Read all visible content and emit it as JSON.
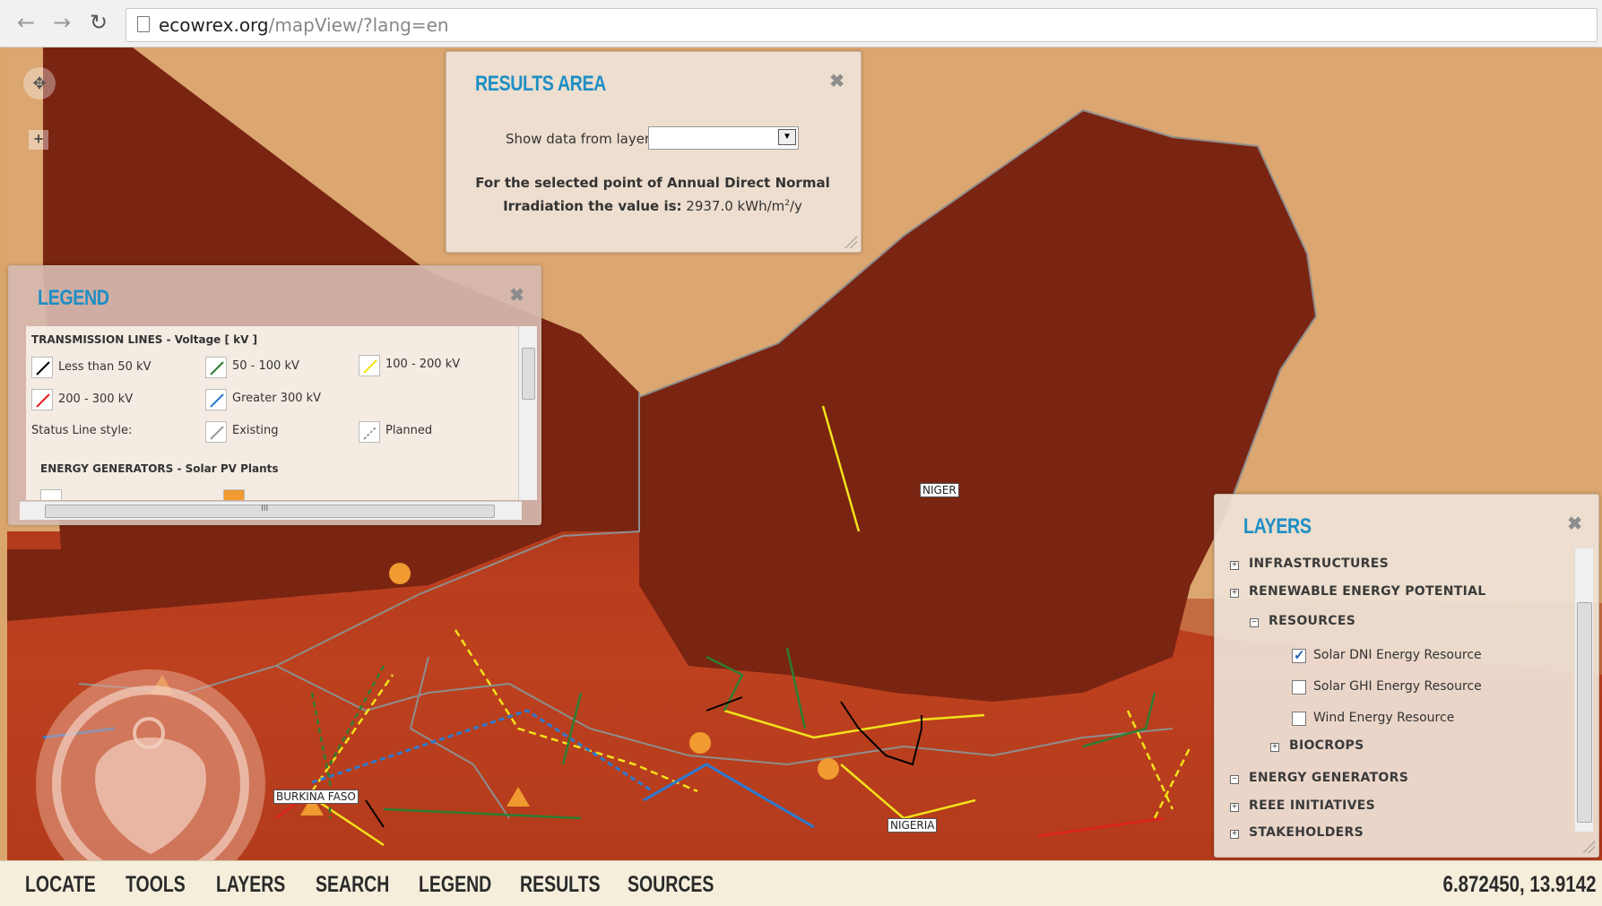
{
  "browser": {
    "url_domain": "ecowrex.org",
    "url_path": "/mapView/?lang=en"
  },
  "map": {
    "labels": {
      "niger": "NIGER",
      "burkina": "BURKINA FASO",
      "nigeria": "NIGERIA"
    }
  },
  "results_panel": {
    "title": "RESULTS AREA",
    "show_label": "Show data from layer:",
    "selected_value": "",
    "msg_line1": "For the selected point of Annual Direct Normal",
    "msg_line2_label": "Irradiation the value is:",
    "msg_value": "2937.0 kWh/m",
    "msg_sup": "2",
    "msg_unit_tail": "/y"
  },
  "legend_panel": {
    "title": "LEGEND",
    "section1": "TRANSMISSION LINES - Voltage [ kV ]",
    "items": [
      {
        "label": "Less than 50 kV",
        "color": "#000000"
      },
      {
        "label": "50 - 100 kV",
        "color": "#2e7d32"
      },
      {
        "label": "100 - 200 kV",
        "color": "#f2e21a"
      },
      {
        "label": "200 - 300 kV",
        "color": "#e02020"
      },
      {
        "label": "Greater 300 kV",
        "color": "#2b7bd1"
      }
    ],
    "status_label": "Status Line style:",
    "existing": "Existing",
    "planned": "Planned",
    "section2": "ENERGY GENERATORS - Solar PV Plants",
    "hscroll_mark": "III"
  },
  "layers_panel": {
    "title": "LAYERS",
    "nodes": {
      "infrastructures": "INFRASTRUCTURES",
      "renewable": "RENEWABLE ENERGY POTENTIAL",
      "resources": "RESOURCES",
      "solar_dni": "Solar DNI Energy Resource",
      "solar_ghi": "Solar GHI Energy Resource",
      "wind": "Wind Energy Resource",
      "biocrops": "BIOCROPS",
      "generators": "ENERGY GENERATORS",
      "reee": "REEE INITIATIVES",
      "stakeholders": "STAKEHOLDERS"
    },
    "checked": {
      "solar_dni": true,
      "solar_ghi": false,
      "wind": false
    }
  },
  "toolbar": {
    "locate": "LOCATE",
    "tools": "TOOLS",
    "layers": "LAYERS",
    "search": "SEARCH",
    "legend": "LEGEND",
    "results": "RESULTS",
    "sources": "SOURCES",
    "coords": "6.872450, 13.9142"
  },
  "colors": {
    "accent": "#1e8fc4",
    "niger_fill": "#7a2412",
    "desert": "#dba670"
  }
}
